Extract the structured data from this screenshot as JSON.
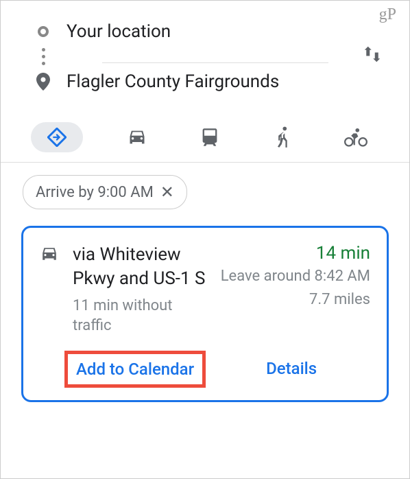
{
  "watermark": "gP",
  "directions": {
    "origin": "Your location",
    "destination": "Flagler County Fairgrounds"
  },
  "filter": {
    "label": "Arrive by 9:00 AM"
  },
  "route": {
    "via": "via Whiteview Pkwy and US-1 S",
    "sub": "11 min without traffic",
    "duration": "14 min",
    "leave": "Leave around 8:42 AM",
    "distance": "7.7 miles"
  },
  "actions": {
    "add_calendar": "Add to Calendar",
    "details": "Details"
  }
}
